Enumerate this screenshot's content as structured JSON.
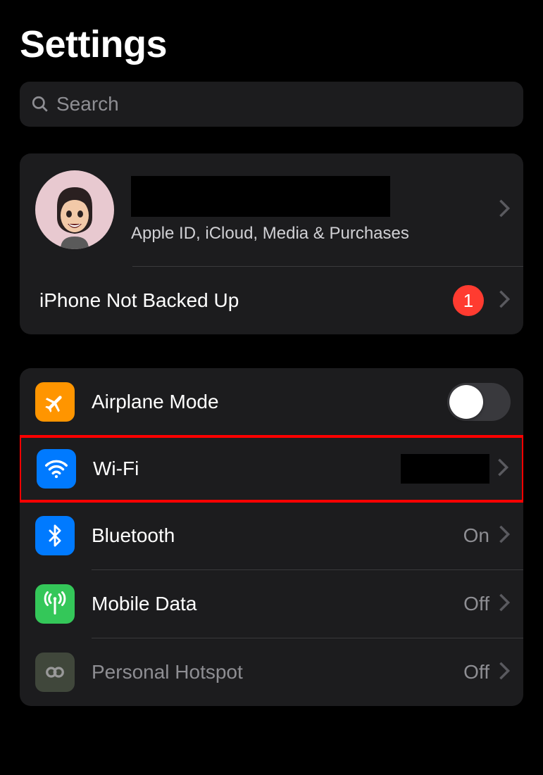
{
  "title": "Settings",
  "search": {
    "placeholder": "Search"
  },
  "profile": {
    "subtitle": "Apple ID, iCloud, Media & Purchases",
    "backup": {
      "label": "iPhone Not Backed Up",
      "badge": "1"
    }
  },
  "settings": {
    "airplane": {
      "label": "Airplane Mode",
      "on": false
    },
    "wifi": {
      "label": "Wi-Fi"
    },
    "bluetooth": {
      "label": "Bluetooth",
      "value": "On"
    },
    "mobile": {
      "label": "Mobile Data",
      "value": "Off"
    },
    "hotspot": {
      "label": "Personal Hotspot",
      "value": "Off"
    }
  }
}
